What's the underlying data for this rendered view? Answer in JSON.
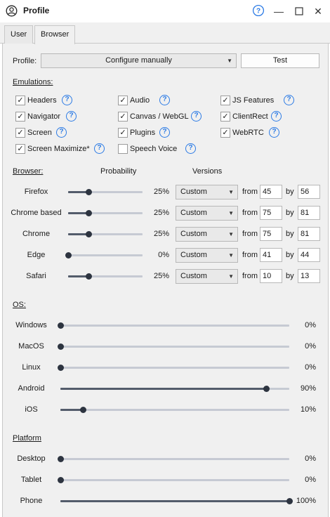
{
  "window": {
    "title": "Profile"
  },
  "tabs": [
    {
      "label": "User"
    },
    {
      "label": "Browser",
      "active": true
    }
  ],
  "profile": {
    "label": "Profile:",
    "select_value": "Configure manually",
    "test_button": "Test"
  },
  "emulations": {
    "title": "Emulations:",
    "items": [
      {
        "label": "Headers",
        "checked": true
      },
      {
        "label": "Audio",
        "checked": true
      },
      {
        "label": "JS Features",
        "checked": true
      },
      {
        "label": "Navigator",
        "checked": true
      },
      {
        "label": "Canvas / WebGL",
        "checked": true
      },
      {
        "label": "ClientRect",
        "checked": true
      },
      {
        "label": "Screen",
        "checked": true
      },
      {
        "label": "Plugins",
        "checked": true
      },
      {
        "label": "WebRTC",
        "checked": true
      },
      {
        "label": "Screen Maximize*",
        "checked": true
      },
      {
        "label": "Speech Voice",
        "checked": false
      }
    ]
  },
  "browser": {
    "title": "Browser:",
    "col_probability": "Probability",
    "col_versions": "Versions",
    "from_label": "from",
    "by_label": "by",
    "rows": [
      {
        "name": "Firefox",
        "percent": "25%",
        "value": 0.25,
        "version_mode": "Custom",
        "from": "45",
        "by": "56"
      },
      {
        "name": "Chrome based",
        "percent": "25%",
        "value": 0.25,
        "version_mode": "Custom",
        "from": "75",
        "by": "81"
      },
      {
        "name": "Chrome",
        "percent": "25%",
        "value": 0.25,
        "version_mode": "Custom",
        "from": "75",
        "by": "81"
      },
      {
        "name": "Edge",
        "percent": "0%",
        "value": 0,
        "version_mode": "Custom",
        "from": "41",
        "by": "44"
      },
      {
        "name": "Safari",
        "percent": "25%",
        "value": 0.25,
        "version_mode": "Custom",
        "from": "10",
        "by": "13"
      }
    ]
  },
  "os": {
    "title": "OS:",
    "rows": [
      {
        "name": "Windows",
        "percent": "0%",
        "value": 0
      },
      {
        "name": "MacOS",
        "percent": "0%",
        "value": 0
      },
      {
        "name": "Linux",
        "percent": "0%",
        "value": 0
      },
      {
        "name": "Android",
        "percent": "90%",
        "value": 0.9
      },
      {
        "name": "iOS",
        "percent": "10%",
        "value": 0.1
      }
    ]
  },
  "platform": {
    "title": "Platform",
    "rows": [
      {
        "name": "Desktop",
        "percent": "0%",
        "value": 0
      },
      {
        "name": "Tablet",
        "percent": "0%",
        "value": 0
      },
      {
        "name": "Phone",
        "percent": "100%",
        "value": 1
      }
    ]
  },
  "colors": {
    "accent": "#2c7be5",
    "slider_fill": "#535c6b",
    "thumb": "#2d3440"
  }
}
